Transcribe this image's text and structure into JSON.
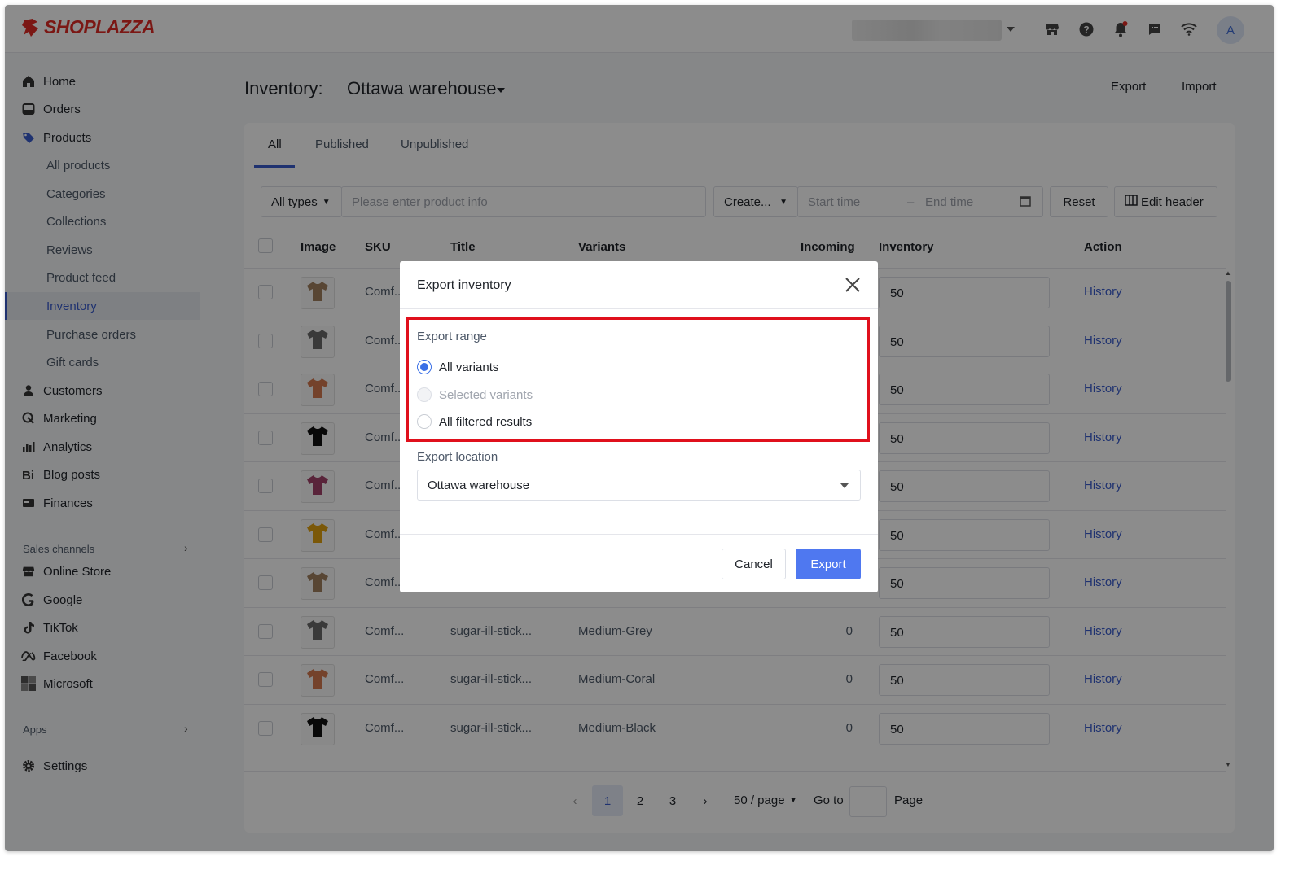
{
  "app": {
    "logo_text": "SHOPLAZZA",
    "avatar_initial": "A",
    "brand_color": "#e02b25",
    "accent_color": "#3a5ccc"
  },
  "topbar": {
    "icons": [
      "store-icon",
      "help-icon",
      "bell-icon",
      "chat-icon",
      "wifi-icon"
    ]
  },
  "sidebar": {
    "items": [
      {
        "label": "Home",
        "icon": "home-icon"
      },
      {
        "label": "Orders",
        "icon": "orders-icon"
      },
      {
        "label": "Products",
        "icon": "tag-icon"
      },
      {
        "label": "All products"
      },
      {
        "label": "Categories"
      },
      {
        "label": "Collections"
      },
      {
        "label": "Reviews"
      },
      {
        "label": "Product feed"
      },
      {
        "label": "Inventory",
        "active": true
      },
      {
        "label": "Purchase orders"
      },
      {
        "label": "Gift cards"
      },
      {
        "label": "Customers",
        "icon": "person-icon"
      },
      {
        "label": "Marketing",
        "icon": "marketing-icon"
      },
      {
        "label": "Analytics",
        "icon": "analytics-icon"
      },
      {
        "label": "Blog posts",
        "icon": "blog-icon"
      },
      {
        "label": "Finances",
        "icon": "finances-icon"
      }
    ],
    "sales_channels_label": "Sales channels",
    "channels": [
      {
        "label": "Online Store",
        "icon": "store-icon"
      },
      {
        "label": "Google",
        "icon": "google-icon"
      },
      {
        "label": "TikTok",
        "icon": "tiktok-icon"
      },
      {
        "label": "Facebook",
        "icon": "meta-icon"
      },
      {
        "label": "Microsoft",
        "icon": "microsoft-icon"
      }
    ],
    "apps_label": "Apps",
    "settings_label": "Settings"
  },
  "header": {
    "title": "Inventory:",
    "location": "Ottawa warehouse",
    "export_label": "Export",
    "import_label": "Import"
  },
  "tabs": [
    "All",
    "Published",
    "Unpublished"
  ],
  "filters": {
    "type": "All types",
    "search_placeholder": "Please enter product info",
    "create": "Create...",
    "start_placeholder": "Start time",
    "end_placeholder": "End time",
    "reset": "Reset",
    "edit_header": "Edit header"
  },
  "table": {
    "columns": [
      "Image",
      "SKU",
      "Title",
      "Variants",
      "Incoming",
      "Inventory",
      "Action"
    ],
    "rows": [
      {
        "sku": "Comf...",
        "title": "",
        "variant": "",
        "incoming": "",
        "inventory": "50",
        "action": "History",
        "color": "#a08060"
      },
      {
        "sku": "Comf...",
        "title": "",
        "variant": "",
        "incoming": "",
        "inventory": "50",
        "action": "History",
        "color": "#6b6b6b"
      },
      {
        "sku": "Comf...",
        "title": "",
        "variant": "",
        "incoming": "",
        "inventory": "50",
        "action": "History",
        "color": "#d4794f"
      },
      {
        "sku": "Comf...",
        "title": "",
        "variant": "",
        "incoming": "",
        "inventory": "50",
        "action": "History",
        "color": "#111111"
      },
      {
        "sku": "Comf...",
        "title": "",
        "variant": "",
        "incoming": "",
        "inventory": "50",
        "action": "History",
        "color": "#a3436a"
      },
      {
        "sku": "Comf...",
        "title": "",
        "variant": "",
        "incoming": "",
        "inventory": "50",
        "action": "History",
        "color": "#e0a010"
      },
      {
        "sku": "Comf...",
        "title": "",
        "variant": "",
        "incoming": "",
        "inventory": "50",
        "action": "History",
        "color": "#a08060"
      },
      {
        "sku": "Comf...",
        "title": "sugar-ill-stick...",
        "variant": "Medium-Grey",
        "incoming": "0",
        "inventory": "50",
        "action": "History",
        "color": "#6b6b6b"
      },
      {
        "sku": "Comf...",
        "title": "sugar-ill-stick...",
        "variant": "Medium-Coral",
        "incoming": "0",
        "inventory": "50",
        "action": "History",
        "color": "#d4794f"
      },
      {
        "sku": "Comf...",
        "title": "sugar-ill-stick...",
        "variant": "Medium-Black",
        "incoming": "0",
        "inventory": "50",
        "action": "History",
        "color": "#111111"
      }
    ]
  },
  "pagination": {
    "pages": [
      "1",
      "2",
      "3"
    ],
    "current": "1",
    "per_page": "50 / page",
    "goto": "Go to",
    "page_label": "Page"
  },
  "modal": {
    "title": "Export inventory",
    "range_label": "Export range",
    "options": [
      {
        "label": "All variants",
        "state": "selected"
      },
      {
        "label": "Selected variants",
        "state": "disabled"
      },
      {
        "label": "All filtered results",
        "state": "normal"
      }
    ],
    "location_label": "Export location",
    "location_value": "Ottawa warehouse",
    "cancel": "Cancel",
    "export": "Export"
  }
}
